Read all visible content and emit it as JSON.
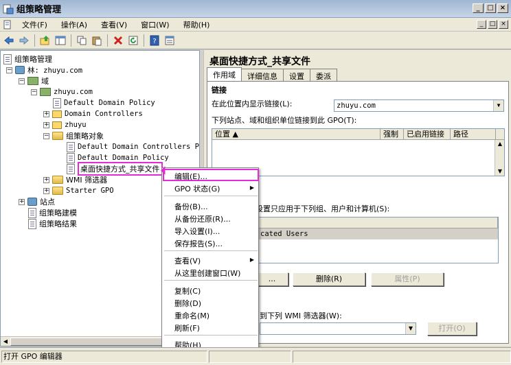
{
  "window": {
    "title": "组策略管理",
    "min": "_",
    "max": "□",
    "close": "×"
  },
  "menubar": {
    "items": [
      "文件(F)",
      "操作(A)",
      "查看(V)",
      "窗口(W)",
      "帮助(H)"
    ],
    "mdi": [
      "_",
      "□",
      "×"
    ]
  },
  "toolbar": {
    "icons": [
      "back-icon",
      "forward-icon",
      "up-folder-icon",
      "show-hide-tree-icon",
      "copy-icon",
      "paste-icon",
      "delete-icon",
      "refresh-icon",
      "help-icon",
      "properties-icon"
    ]
  },
  "tree": {
    "root": "组策略管理",
    "forest": "林: zhuyu.com",
    "domains": "域",
    "domain": "zhuyu.com",
    "ddp": "Default Domain Policy",
    "dc": "Domain Controllers",
    "ou": "zhuyu",
    "gpo_container": "组策略对象",
    "gpo1": "Default Domain Controllers Po",
    "gpo2": "Default Domain Policy",
    "gpo3": "桌面快捷方式_共享文件",
    "wmi": "WMI 筛选器",
    "starter": "Starter GPO",
    "sites": "站点",
    "modeling": "组策略建模",
    "results": "组策略结果"
  },
  "right": {
    "title": "桌面快捷方式_共享文件",
    "tabs": [
      "作用域",
      "详细信息",
      "设置",
      "委派"
    ],
    "links_heading": "链接",
    "display_links_label": "在此位置内显示链接(L):",
    "display_links_value": "zhuyu.com",
    "linked_desc": "下列站点、域和组织单位链接到此 GPO(T):",
    "columns": [
      "位置",
      "强制",
      "已启用链接",
      "路径"
    ],
    "filter_desc": "设置只应用于下列组、用户和计算机(S):",
    "filter_value": "cated Users",
    "btn_add": "...",
    "btn_remove": "删除(R)",
    "btn_properties": "属性(P)",
    "wmi_desc": "到下列 WMI 筛选器(W):",
    "btn_open": "打开(O)"
  },
  "context_menu": {
    "items": [
      "编辑(E)...",
      "GPO 状态(G)",
      "备份(B)...",
      "从备份还原(R)...",
      "导入设置(I)...",
      "保存报告(S)...",
      "查看(V)",
      "从这里创建窗口(W)",
      "复制(C)",
      "删除(D)",
      "重命名(M)",
      "刷新(F)",
      "帮助(H)"
    ]
  },
  "status": {
    "text": "打开 GPO 编辑器"
  },
  "colors": {
    "highlight": "#e02bd6",
    "title_bg": "#c6d5e8"
  }
}
